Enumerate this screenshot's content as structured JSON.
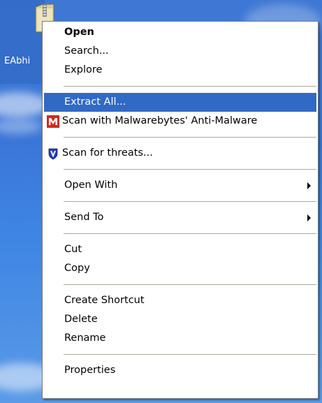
{
  "desktop": {
    "icon_label": "EAbhi"
  },
  "menu": {
    "open": "Open",
    "search": "Search...",
    "explore": "Explore",
    "extract_all": "Extract All...",
    "scan_malwarebytes": "Scan with Malwarebytes' Anti-Malware",
    "scan_threats": "Scan for threats...",
    "open_with": "Open With",
    "send_to": "Send To",
    "cut": "Cut",
    "copy": "Copy",
    "create_shortcut": "Create Shortcut",
    "delete": "Delete",
    "rename": "Rename",
    "properties": "Properties"
  },
  "colors": {
    "highlight": "#316ac5",
    "malwarebytes_red": "#d22a1e",
    "shield_blue": "#1e3fb8"
  },
  "icons": {
    "malwarebytes": "malwarebytes-icon",
    "shield": "shield-icon",
    "submenu": "chevron-right-icon"
  }
}
